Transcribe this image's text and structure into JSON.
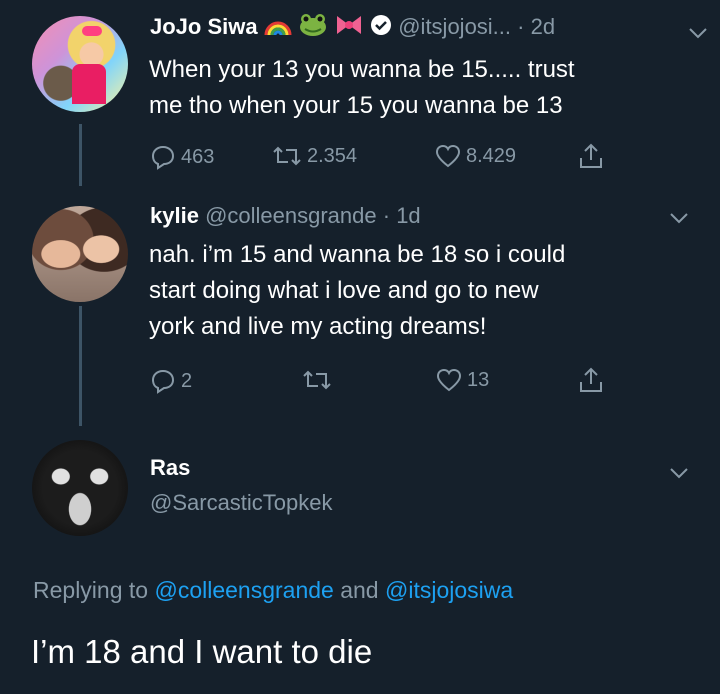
{
  "tweets": [
    {
      "name": "JoJo Siwa",
      "emojis": [
        "rainbow",
        "frog",
        "bow"
      ],
      "verified": true,
      "handle": "@itsjojosi...",
      "time": "· 2d",
      "text_lines": [
        "When your 13 you wanna be 15..... trust",
        "me tho when your 15 you wanna be 13"
      ],
      "replies": "463",
      "retweets": "2.354",
      "likes": "8.429"
    },
    {
      "name": "kylie",
      "handle": "@colleensgrande",
      "time": "· 1d",
      "text_lines": [
        "nah. i’m 15 and wanna be 18 so i could",
        "start doing what i love and go to new",
        "york and live my acting dreams!"
      ],
      "replies": "2",
      "likes": "13"
    }
  ],
  "focused": {
    "name": "Ras",
    "handle": "@SarcasticTopkek",
    "replying_prefix": "Replying to",
    "replying_to_1": "@colleensgrande",
    "replying_and": "and",
    "replying_to_2": "@itsjojosiwa",
    "text": "I’m 18 and I want to die"
  },
  "colors": {
    "background": "#15202b",
    "secondary_text": "#8899a6",
    "link": "#1da1f2",
    "verified": "#ffffff",
    "thread_line": "#3d5466"
  },
  "icons": [
    "reply-icon",
    "retweet-icon",
    "like-icon",
    "share-icon",
    "chevron-down-icon",
    "verified-badge-icon"
  ]
}
